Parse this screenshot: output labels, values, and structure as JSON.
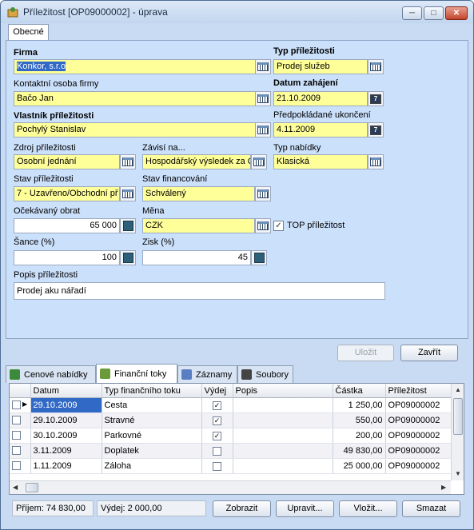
{
  "window": {
    "title": "Příležitost [OP09000002] - úprava"
  },
  "tabs": {
    "main": "Obecné"
  },
  "form": {
    "firma_label": "Firma",
    "firma_value": "Konkor, s.r.o",
    "kontakt_label": "Kontaktní osoba firmy",
    "kontakt_value": "Bačo Jan",
    "vlastnik_label": "Vlastník příležitosti",
    "vlastnik_value": "Pochylý Stanislav",
    "zdroj_label": "Zdroj příležitosti",
    "zdroj_value": "Osobní jednání",
    "zavisi_label": "Závisí na...",
    "zavisi_value": "Hospodářský výsledek za Q",
    "stav_label": "Stav příležitosti",
    "stav_value": "7 - Uzavřeno/Obchodní př",
    "stavfin_label": "Stav financování",
    "stavfin_value": "Schválený",
    "obrat_label": "Očekávaný obrat",
    "obrat_value": "65 000",
    "mena_label": "Měna",
    "mena_value": "CZK",
    "sance_label": "Šance (%)",
    "sance_value": "100",
    "zisk_label": "Zisk (%)",
    "zisk_value": "45",
    "popis_label": "Popis příležitosti",
    "popis_value": "Prodej aku nářadí",
    "typ_label": "Typ příležitosti",
    "typ_value": "Prodej služeb",
    "datum_label": "Datum zahájení",
    "datum_value": "21.10.2009",
    "ukonceni_label": "Předpokládané ukončení",
    "ukonceni_value": "4.11.2009",
    "typnab_label": "Typ nabídky",
    "typnab_value": "Klasická",
    "top_label": "TOP příležitost",
    "top_checked": true
  },
  "buttons": {
    "ulozit": "Uložit",
    "zavrit": "Zavřít",
    "zobrazit": "Zobrazit",
    "upravit": "Upravit...",
    "vlozit": "Vložit...",
    "smazat": "Smazat"
  },
  "bottom_tabs": [
    "Cenové nabídky",
    "Finanční toky",
    "Záznamy",
    "Soubory"
  ],
  "grid": {
    "columns": [
      "Datum",
      "Typ finančního toku",
      "Výdej",
      "Popis",
      "Částka",
      "Příležitost"
    ],
    "rows": [
      {
        "datum": "29.10.2009",
        "typ": "Cesta",
        "vydej": true,
        "popis": "",
        "castka": "1 250,00",
        "prilezitost": "OP09000002"
      },
      {
        "datum": "29.10.2009",
        "typ": "Stravné",
        "vydej": true,
        "popis": "",
        "castka": "550,00",
        "prilezitost": "OP09000002"
      },
      {
        "datum": "30.10.2009",
        "typ": "Parkovné",
        "vydej": true,
        "popis": "",
        "castka": "200,00",
        "prilezitost": "OP09000002"
      },
      {
        "datum": "3.11.2009",
        "typ": "Doplatek",
        "vydej": false,
        "popis": "",
        "castka": "49 830,00",
        "prilezitost": "OP09000002"
      },
      {
        "datum": "1.11.2009",
        "typ": "Záloha",
        "vydej": false,
        "popis": "",
        "castka": "25 000,00",
        "prilezitost": "OP09000002"
      }
    ]
  },
  "status": {
    "prijem": "Příjem: 74 830,00",
    "vydej": "Výdej: 2 000,00"
  }
}
